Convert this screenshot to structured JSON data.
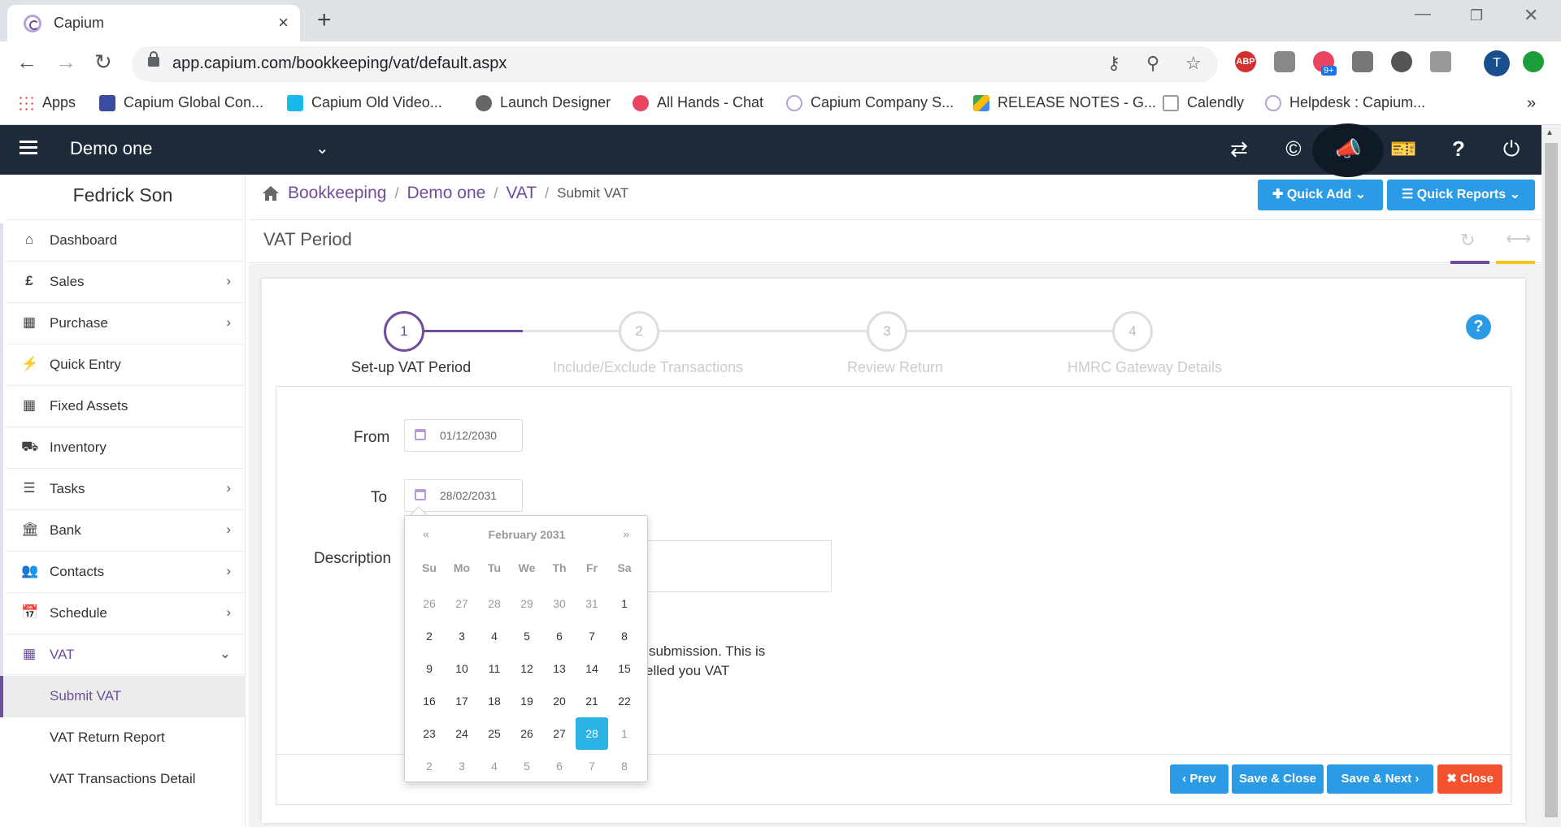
{
  "browser": {
    "tab_title": "Capium",
    "tab_close": "×",
    "new_tab": "+",
    "url": "app.capium.com/bookkeeping/vat/default.aspx",
    "ext_abp": "ABP",
    "ext_badge": "9+",
    "profile_initial": "T",
    "bookmarks": [
      {
        "label": "Apps"
      },
      {
        "label": "Capium Global Con..."
      },
      {
        "label": "Capium Old Video..."
      },
      {
        "label": "Launch Designer"
      },
      {
        "label": "All Hands - Chat"
      },
      {
        "label": "Capium Company S..."
      },
      {
        "label": "RELEASE NOTES - G..."
      },
      {
        "label": "Calendly"
      },
      {
        "label": "Helpdesk : Capium..."
      }
    ],
    "bookmarks_more": "»"
  },
  "header": {
    "org_name": "Demo one"
  },
  "sidebar": {
    "user_name": "Fedrick Son",
    "items": [
      {
        "label": "Dashboard",
        "icon": "dashboard-icon"
      },
      {
        "label": "Sales",
        "icon": "pound-icon"
      },
      {
        "label": "Purchase",
        "icon": "grid-icon"
      },
      {
        "label": "Quick Entry",
        "icon": "bolt-icon"
      },
      {
        "label": "Fixed Assets",
        "icon": "building-icon"
      },
      {
        "label": "Inventory",
        "icon": "truck-icon"
      },
      {
        "label": "Tasks",
        "icon": "tasks-icon"
      },
      {
        "label": "Bank",
        "icon": "bank-icon"
      },
      {
        "label": "Contacts",
        "icon": "users-icon"
      },
      {
        "label": "Schedule",
        "icon": "calendar-icon"
      },
      {
        "label": "VAT",
        "icon": "calculator-icon"
      }
    ],
    "sub_items": [
      {
        "label": "Submit VAT",
        "active": true
      },
      {
        "label": "VAT Return Report",
        "active": false
      },
      {
        "label": "VAT Transactions Detail",
        "active": false
      }
    ]
  },
  "breadcrumb": {
    "items": [
      "Bookkeeping",
      "Demo one",
      "VAT"
    ],
    "current": "Submit VAT",
    "separator": "/"
  },
  "toolbar": {
    "quick_add": "Quick Add",
    "quick_reports": "Quick Reports"
  },
  "page": {
    "section_title": "VAT Period"
  },
  "wizard": {
    "steps": [
      {
        "number": "1",
        "label": "Set-up VAT Period",
        "active": true
      },
      {
        "number": "2",
        "label": "Include/Exclude Transactions",
        "active": false
      },
      {
        "number": "3",
        "label": "Review Return",
        "active": false
      },
      {
        "number": "4",
        "label": "HMRC Gateway Details",
        "active": false
      }
    ],
    "help": "?"
  },
  "form": {
    "from_label": "From",
    "from_value": "01/12/2030",
    "to_label": "To",
    "to_value": "28/02/2031",
    "description_label": "Description",
    "partial_text_1": "submission. This is",
    "partial_text_2": "elled you VAT"
  },
  "datepicker": {
    "title": "February 2031",
    "prev": "«",
    "next": "»",
    "weekdays": [
      "Su",
      "Mo",
      "Tu",
      "We",
      "Th",
      "Fr",
      "Sa"
    ],
    "weeks": [
      [
        "26",
        "27",
        "28",
        "29",
        "30",
        "31",
        "1"
      ],
      [
        "2",
        "3",
        "4",
        "5",
        "6",
        "7",
        "8"
      ],
      [
        "9",
        "10",
        "11",
        "12",
        "13",
        "14",
        "15"
      ],
      [
        "16",
        "17",
        "18",
        "19",
        "20",
        "21",
        "22"
      ],
      [
        "23",
        "24",
        "25",
        "26",
        "27",
        "28",
        "1"
      ],
      [
        "2",
        "3",
        "4",
        "5",
        "6",
        "7",
        "8"
      ]
    ],
    "selected": "28"
  },
  "footer": {
    "prev": "Prev",
    "save_close": "Save & Close",
    "save_next": "Save & Next",
    "close": "Close"
  },
  "colors": {
    "brand_purple": "#6f4c9c",
    "header_bg": "#1c2a3a",
    "button_blue": "#2b9be6",
    "close_red": "#f2522e",
    "selected_day": "#2ab4e6"
  }
}
